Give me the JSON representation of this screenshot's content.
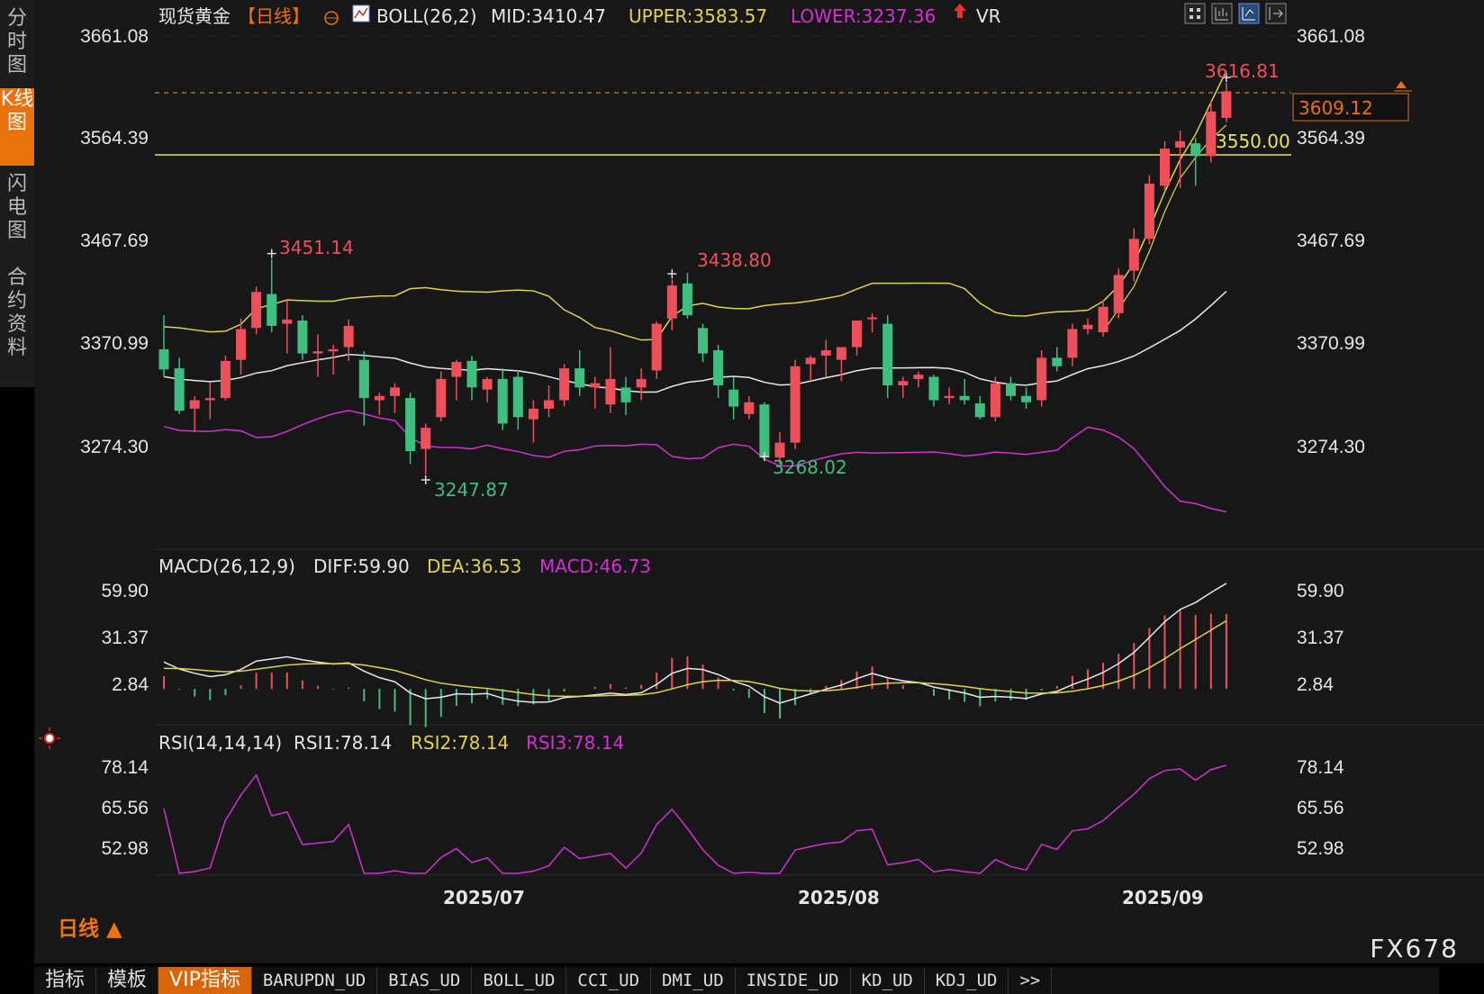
{
  "left_tabs": [
    "分时图",
    "K线图",
    "闪电图",
    "合约资料"
  ],
  "left_tab_active": 1,
  "header": {
    "symbol": "现货黄金",
    "period_tag": "【日线】",
    "boll_label": "BOLL(26,2)",
    "mid": "MID:3410.47",
    "upper": "UPPER:3583.57",
    "lower": "LOWER:3237.36",
    "vr": "VR"
  },
  "price_axis": [
    "3661.08",
    "3564.39",
    "3467.69",
    "3370.99",
    "3274.30"
  ],
  "annotations": {
    "high1": "3451.14",
    "high2": "3438.80",
    "high3": "3616.81",
    "low1": "3247.87",
    "low2": "3268.02",
    "hline_value": "3550.00",
    "last_price": "3609.12"
  },
  "macd": {
    "label": "MACD(26,12,9)",
    "diff": "DIFF:59.90",
    "dea": "DEA:36.53",
    "macd": "MACD:46.73",
    "axis": [
      "59.90",
      "31.37",
      "2.84"
    ]
  },
  "rsi": {
    "label": "RSI(14,14,14)",
    "rsi1": "RSI1:78.14",
    "rsi2": "RSI2:78.14",
    "rsi3": "RSI3:78.14",
    "axis": [
      "78.14",
      "65.56",
      "52.98"
    ]
  },
  "x_labels": [
    "2025/07",
    "2025/08",
    "2025/09"
  ],
  "period": "日线",
  "bottom_tabs": [
    "指标",
    "模板",
    "VIP指标",
    "BARUPDN_UD",
    "BIAS_UD",
    "BOLL_UD",
    "CCI_UD",
    "DMI_UD",
    "INSIDE_UD",
    "KD_UD",
    "KDJ_UD",
    ">>"
  ],
  "watermark": "FX678",
  "colors": {
    "up": "#ef4f5b",
    "down": "#3fbf7f",
    "upper": "#e0d34a",
    "lower": "#d52fd5",
    "mid": "#e8e8e8",
    "hline": "#e6e65a",
    "accent": "#e8720c"
  },
  "chart_data": {
    "type": "candlestick",
    "price_range": [
      3200,
      3680
    ],
    "candles": [
      {
        "o": 3366,
        "h": 3398,
        "l": 3340,
        "c": 3347
      },
      {
        "o": 3348,
        "h": 3358,
        "l": 3305,
        "c": 3308
      },
      {
        "o": 3310,
        "h": 3322,
        "l": 3288,
        "c": 3318
      },
      {
        "o": 3318,
        "h": 3335,
        "l": 3300,
        "c": 3320
      },
      {
        "o": 3320,
        "h": 3360,
        "l": 3318,
        "c": 3355
      },
      {
        "o": 3356,
        "h": 3395,
        "l": 3342,
        "c": 3385
      },
      {
        "o": 3386,
        "h": 3425,
        "l": 3380,
        "c": 3420
      },
      {
        "o": 3418,
        "h": 3451,
        "l": 3382,
        "c": 3388
      },
      {
        "o": 3390,
        "h": 3412,
        "l": 3362,
        "c": 3394
      },
      {
        "o": 3393,
        "h": 3398,
        "l": 3356,
        "c": 3362
      },
      {
        "o": 3362,
        "h": 3380,
        "l": 3340,
        "c": 3364
      },
      {
        "o": 3364,
        "h": 3370,
        "l": 3342,
        "c": 3366
      },
      {
        "o": 3368,
        "h": 3394,
        "l": 3355,
        "c": 3388
      },
      {
        "o": 3356,
        "h": 3364,
        "l": 3294,
        "c": 3320
      },
      {
        "o": 3318,
        "h": 3325,
        "l": 3304,
        "c": 3322
      },
      {
        "o": 3322,
        "h": 3334,
        "l": 3306,
        "c": 3330
      },
      {
        "o": 3320,
        "h": 3325,
        "l": 3258,
        "c": 3270
      },
      {
        "o": 3272,
        "h": 3296,
        "l": 3248,
        "c": 3292
      },
      {
        "o": 3302,
        "h": 3345,
        "l": 3298,
        "c": 3338
      },
      {
        "o": 3340,
        "h": 3356,
        "l": 3318,
        "c": 3354
      },
      {
        "o": 3355,
        "h": 3360,
        "l": 3318,
        "c": 3330
      },
      {
        "o": 3328,
        "h": 3340,
        "l": 3316,
        "c": 3338
      },
      {
        "o": 3338,
        "h": 3348,
        "l": 3290,
        "c": 3296
      },
      {
        "o": 3340,
        "h": 3346,
        "l": 3290,
        "c": 3302
      },
      {
        "o": 3300,
        "h": 3318,
        "l": 3278,
        "c": 3310
      },
      {
        "o": 3310,
        "h": 3332,
        "l": 3302,
        "c": 3318
      },
      {
        "o": 3318,
        "h": 3352,
        "l": 3312,
        "c": 3348
      },
      {
        "o": 3348,
        "h": 3365,
        "l": 3322,
        "c": 3330
      },
      {
        "o": 3330,
        "h": 3340,
        "l": 3310,
        "c": 3334
      },
      {
        "o": 3314,
        "h": 3368,
        "l": 3306,
        "c": 3338
      },
      {
        "o": 3330,
        "h": 3340,
        "l": 3304,
        "c": 3316
      },
      {
        "o": 3330,
        "h": 3348,
        "l": 3318,
        "c": 3338
      },
      {
        "o": 3346,
        "h": 3392,
        "l": 3338,
        "c": 3390
      },
      {
        "o": 3395,
        "h": 3432,
        "l": 3384,
        "c": 3426
      },
      {
        "o": 3428,
        "h": 3438,
        "l": 3395,
        "c": 3398
      },
      {
        "o": 3386,
        "h": 3390,
        "l": 3354,
        "c": 3362
      },
      {
        "o": 3365,
        "h": 3370,
        "l": 3320,
        "c": 3332
      },
      {
        "o": 3328,
        "h": 3340,
        "l": 3300,
        "c": 3312
      },
      {
        "o": 3305,
        "h": 3322,
        "l": 3300,
        "c": 3316
      },
      {
        "o": 3314,
        "h": 3316,
        "l": 3270,
        "c": 3264
      },
      {
        "o": 3264,
        "h": 3288,
        "l": 3258,
        "c": 3278
      },
      {
        "o": 3278,
        "h": 3356,
        "l": 3272,
        "c": 3350
      },
      {
        "o": 3352,
        "h": 3360,
        "l": 3336,
        "c": 3358
      },
      {
        "o": 3360,
        "h": 3375,
        "l": 3340,
        "c": 3365
      },
      {
        "o": 3356,
        "h": 3365,
        "l": 3336,
        "c": 3368
      },
      {
        "o": 3368,
        "h": 3390,
        "l": 3360,
        "c": 3393
      },
      {
        "o": 3396,
        "h": 3400,
        "l": 3382,
        "c": 3396
      },
      {
        "o": 3390,
        "h": 3398,
        "l": 3320,
        "c": 3332
      },
      {
        "o": 3332,
        "h": 3340,
        "l": 3320,
        "c": 3336
      },
      {
        "o": 3338,
        "h": 3345,
        "l": 3330,
        "c": 3342
      },
      {
        "o": 3340,
        "h": 3342,
        "l": 3312,
        "c": 3318
      },
      {
        "o": 3320,
        "h": 3330,
        "l": 3314,
        "c": 3322
      },
      {
        "o": 3322,
        "h": 3338,
        "l": 3314,
        "c": 3318
      },
      {
        "o": 3315,
        "h": 3322,
        "l": 3300,
        "c": 3302
      },
      {
        "o": 3302,
        "h": 3340,
        "l": 3298,
        "c": 3334
      },
      {
        "o": 3334,
        "h": 3340,
        "l": 3318,
        "c": 3322
      },
      {
        "o": 3322,
        "h": 3330,
        "l": 3310,
        "c": 3316
      },
      {
        "o": 3318,
        "h": 3365,
        "l": 3312,
        "c": 3358
      },
      {
        "o": 3358,
        "h": 3368,
        "l": 3345,
        "c": 3350
      },
      {
        "o": 3358,
        "h": 3390,
        "l": 3350,
        "c": 3385
      },
      {
        "o": 3385,
        "h": 3395,
        "l": 3380,
        "c": 3389
      },
      {
        "o": 3382,
        "h": 3412,
        "l": 3378,
        "c": 3406
      },
      {
        "o": 3400,
        "h": 3442,
        "l": 3395,
        "c": 3436
      },
      {
        "o": 3440,
        "h": 3480,
        "l": 3430,
        "c": 3470
      },
      {
        "o": 3470,
        "h": 3530,
        "l": 3465,
        "c": 3522
      },
      {
        "o": 3520,
        "h": 3562,
        "l": 3515,
        "c": 3555
      },
      {
        "o": 3556,
        "h": 3572,
        "l": 3518,
        "c": 3562
      },
      {
        "o": 3560,
        "h": 3565,
        "l": 3520,
        "c": 3548
      },
      {
        "o": 3548,
        "h": 3600,
        "l": 3542,
        "c": 3590
      },
      {
        "o": 3584,
        "h": 3617,
        "l": 3580,
        "c": 3609
      }
    ]
  }
}
